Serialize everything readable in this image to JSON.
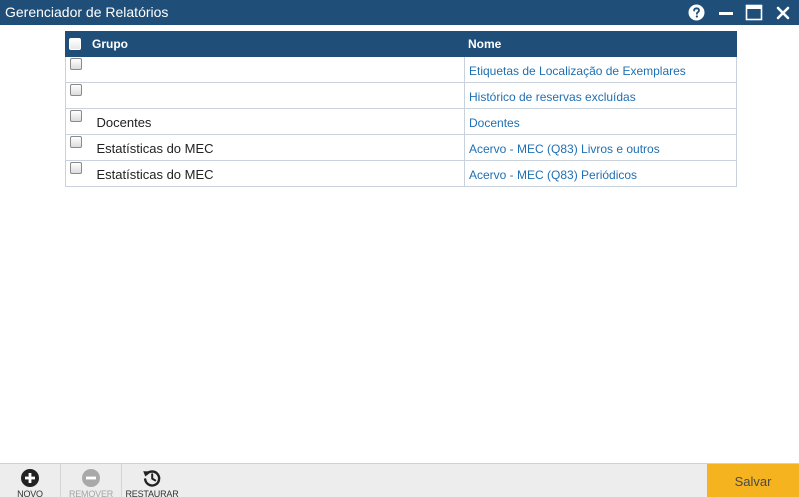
{
  "window": {
    "title": "Gerenciador de Relatórios",
    "controls": {
      "help_icon": "help-icon",
      "minimize_icon": "minimize-icon",
      "maximize_icon": "maximize-icon",
      "close_icon": "close-icon"
    }
  },
  "table": {
    "columns": {
      "group": "Grupo",
      "name": "Nome"
    },
    "rows": [
      {
        "group": "",
        "name": "Etiquetas de Localização de Exemplares"
      },
      {
        "group": "",
        "name": "Histórico de reservas excluídas"
      },
      {
        "group": "Docentes",
        "name": "Docentes"
      },
      {
        "group": "Estatísticas do MEC",
        "name": "Acervo - MEC (Q83) Livros e outros"
      },
      {
        "group": "Estatísticas do MEC",
        "name": "Acervo - MEC (Q83) Periódicos"
      }
    ]
  },
  "toolbar": {
    "new_label": "NOVO",
    "remove_label": "REMOVER",
    "restore_label": "RESTAURAR",
    "save_label": "Salvar"
  },
  "colors": {
    "titlebar": "#1f4e79",
    "header": "#1f4e79",
    "link": "#1f6fb2",
    "save_button": "#f5b31f",
    "toolbar": "#ededed"
  }
}
